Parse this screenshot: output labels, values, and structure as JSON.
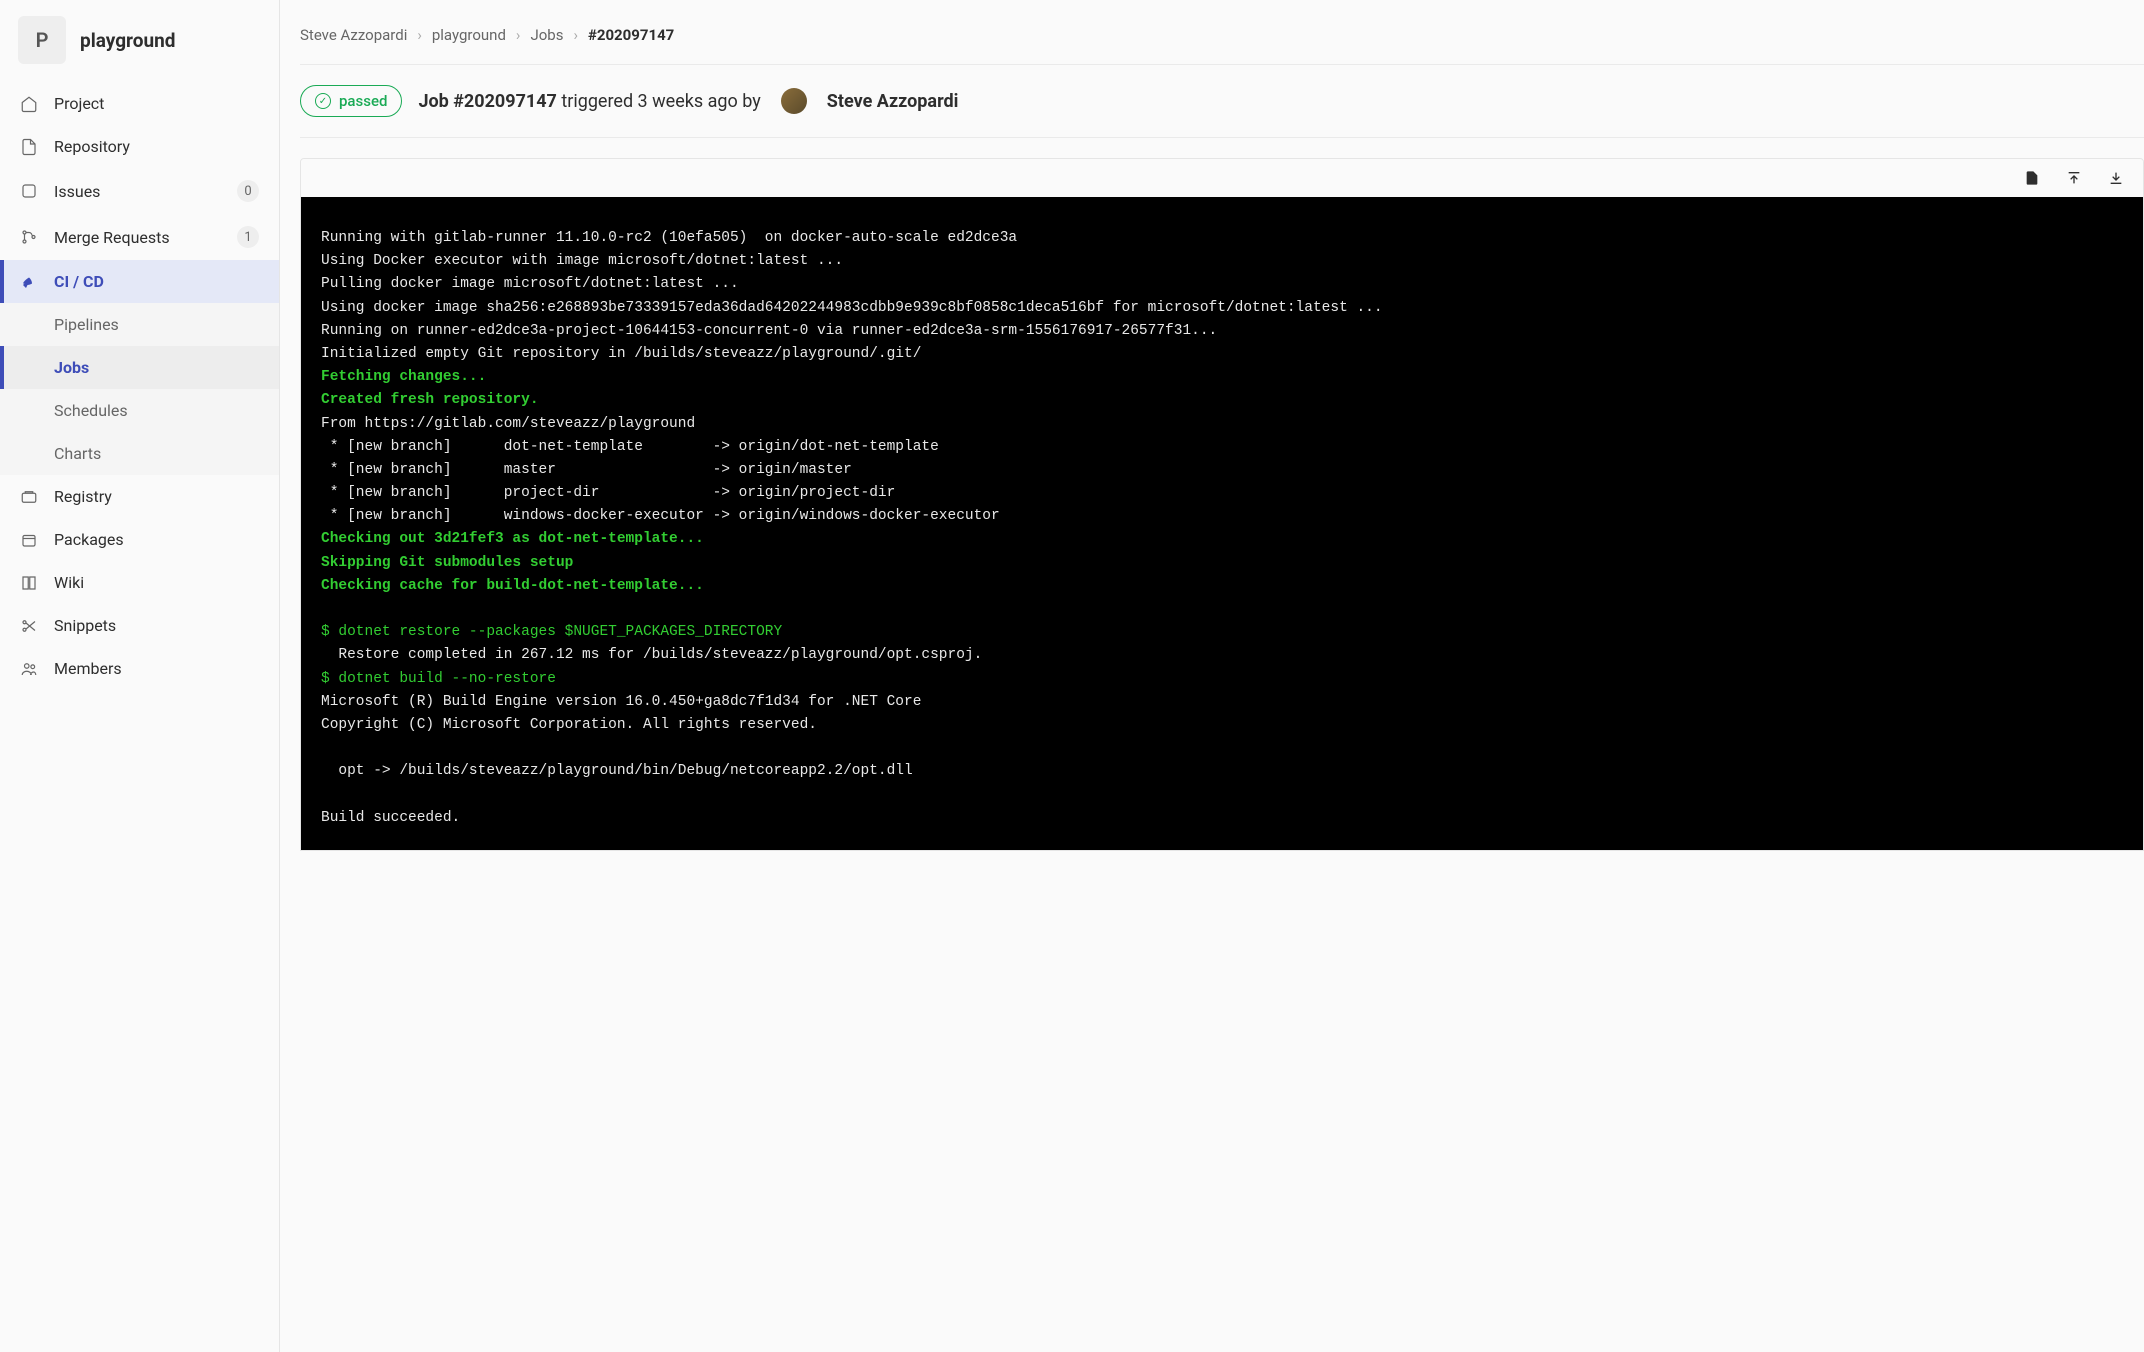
{
  "project": {
    "badge": "P",
    "name": "playground"
  },
  "sidebar": {
    "items": [
      {
        "label": "Project"
      },
      {
        "label": "Repository"
      },
      {
        "label": "Issues",
        "badge": "0"
      },
      {
        "label": "Merge Requests",
        "badge": "1"
      },
      {
        "label": "CI / CD"
      },
      {
        "label": "Registry"
      },
      {
        "label": "Packages"
      },
      {
        "label": "Wiki"
      },
      {
        "label": "Snippets"
      },
      {
        "label": "Members"
      }
    ],
    "sub": [
      {
        "label": "Pipelines"
      },
      {
        "label": "Jobs"
      },
      {
        "label": "Schedules"
      },
      {
        "label": "Charts"
      }
    ]
  },
  "breadcrumb": {
    "root": "Steve Azzopardi",
    "project": "playground",
    "section": "Jobs",
    "current": "#202097147"
  },
  "status": {
    "label": "passed"
  },
  "job": {
    "title_prefix": "Job #202097147",
    "triggered": " triggered 3 weeks ago by ",
    "author": "Steve Azzopardi"
  },
  "log": {
    "l1": "Running with gitlab-runner 11.10.0-rc2 (10efa505)  on docker-auto-scale ed2dce3a",
    "l2": "Using Docker executor with image microsoft/dotnet:latest ...",
    "l3": "Pulling docker image microsoft/dotnet:latest ...",
    "l4": "Using docker image sha256:e268893be73339157eda36dad64202244983cdbb9e939c8bf0858c1deca516bf for microsoft/dotnet:latest ...",
    "l5": "Running on runner-ed2dce3a-project-10644153-concurrent-0 via runner-ed2dce3a-srm-1556176917-26577f31...",
    "l6": "Initialized empty Git repository in /builds/steveazz/playground/.git/",
    "l7": "Fetching changes...",
    "l8": "Created fresh repository.",
    "l9": "From https://gitlab.com/steveazz/playground",
    "l10": " * [new branch]      dot-net-template        -> origin/dot-net-template",
    "l11": " * [new branch]      master                  -> origin/master",
    "l12": " * [new branch]      project-dir             -> origin/project-dir",
    "l13": " * [new branch]      windows-docker-executor -> origin/windows-docker-executor",
    "l14": "Checking out 3d21fef3 as dot-net-template...",
    "l15": "Skipping Git submodules setup",
    "l16": "Checking cache for build-dot-net-template...",
    "l17": "$ dotnet restore --packages $NUGET_PACKAGES_DIRECTORY",
    "l18": "  Restore completed in 267.12 ms for /builds/steveazz/playground/opt.csproj.",
    "l19": "$ dotnet build --no-restore",
    "l20": "Microsoft (R) Build Engine version 16.0.450+ga8dc7f1d34 for .NET Core",
    "l21": "Copyright (C) Microsoft Corporation. All rights reserved.",
    "l22": "  opt -> /builds/steveazz/playground/bin/Debug/netcoreapp2.2/opt.dll",
    "l23": "Build succeeded."
  }
}
